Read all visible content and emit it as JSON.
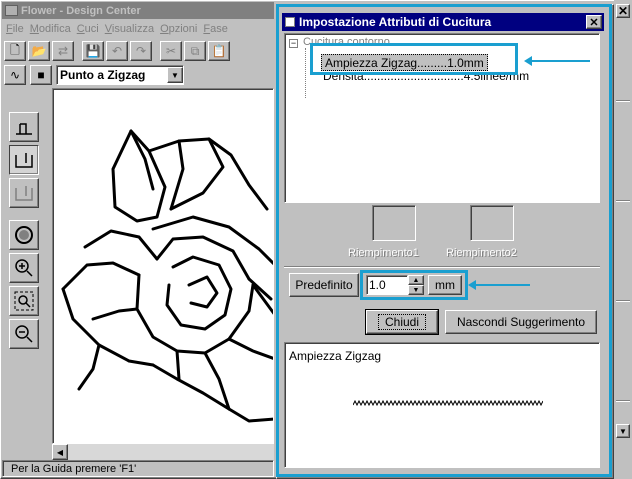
{
  "main_window": {
    "title": "Flower - Design Center",
    "menu": [
      "File",
      "Modifica",
      "Cuci",
      "Visualizza",
      "Opzioni",
      "Fase"
    ],
    "toolbar_icons": [
      "new-icon",
      "open-icon",
      "import-icon",
      "save-icon",
      "undo-icon",
      "redo-icon",
      "cut-icon",
      "copy-icon",
      "paste-icon"
    ],
    "stitch_type": "Punto a Zigzag",
    "tools": [
      "stitch-line-tool-icon",
      "stitch-region-tool-icon",
      "stitch-region-alt-icon",
      "fill-circle-icon",
      "zoom-in-icon",
      "zoom-fit-icon",
      "zoom-out-icon"
    ],
    "status_text": "Per la Guida premere 'F1'"
  },
  "dialog": {
    "title": "Impostazione Attributi di Cucitura",
    "close": "✕",
    "tree": {
      "root": "Cucitura contorno",
      "items": [
        {
          "name": "Ampiezza Zigzag",
          "dots": ".........",
          "value": "1.0mm"
        },
        {
          "name": "Densità",
          "dots": "..............................",
          "value": "4.5linee/mm"
        }
      ]
    },
    "fills": [
      "Riempimento1",
      "Riempimento2"
    ],
    "default_button": "Predefinito",
    "spin_value": "1.0",
    "spin_unit": "mm",
    "close_button": "Chiudi",
    "hide_hint_button": "Nascondi Suggerimento",
    "hint_title": "Ampiezza Zigzag"
  },
  "colors": {
    "highlight": "#1a9fd0",
    "dialog_title_bg": "#000080",
    "face": "#c0c0c0"
  }
}
